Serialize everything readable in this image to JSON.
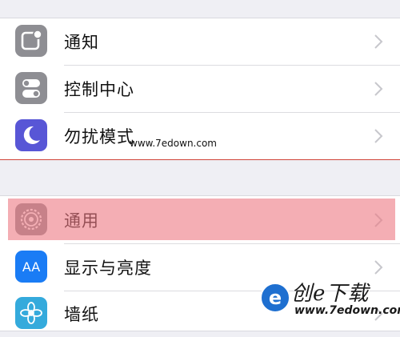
{
  "settings": {
    "group1": [
      {
        "label": "通知",
        "icon": "notifications-icon",
        "color": "#8e8e93"
      },
      {
        "label": "控制中心",
        "icon": "control-center-icon",
        "color": "#8e8e93"
      },
      {
        "label": "勿扰模式",
        "icon": "moon-icon",
        "color": "#5856d6"
      }
    ],
    "group2": [
      {
        "label": "通用",
        "icon": "gear-icon",
        "color": "#8e8e93"
      },
      {
        "label": "显示与亮度",
        "icon": "display-brightness-icon",
        "color": "#1a7cf5",
        "icon_text": "AA"
      },
      {
        "label": "墙纸",
        "icon": "wallpaper-icon",
        "color": "#34aadc"
      }
    ],
    "highlighted_item": "通用"
  },
  "watermark": {
    "text": "www.7edown.com",
    "logo_brand": "创e下载",
    "logo_url": "www.7edown.com"
  }
}
